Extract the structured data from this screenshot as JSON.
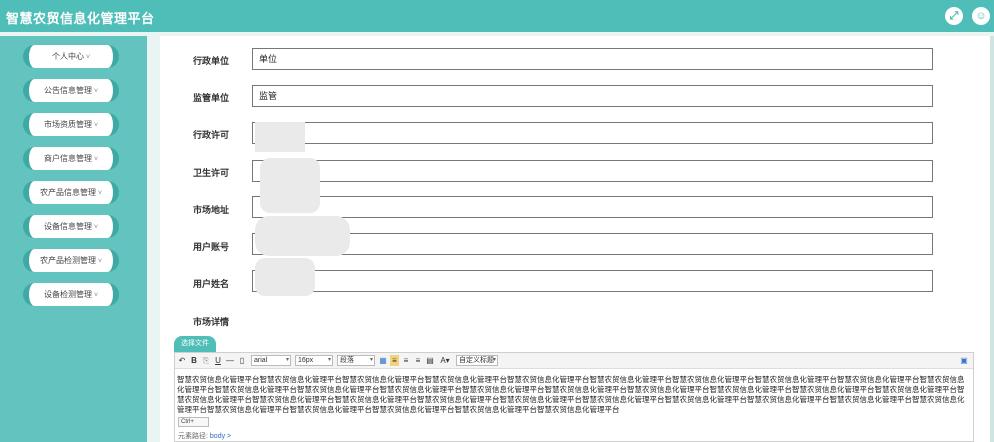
{
  "app": {
    "title": "智慧农贸信息化管理平台"
  },
  "topbar": {
    "fullscreen_icon": "fullscreen-icon",
    "user_icon": "user-icon"
  },
  "sidebar": {
    "items": [
      {
        "label": "个人中心"
      },
      {
        "label": "公告信息管理"
      },
      {
        "label": "市场资质管理"
      },
      {
        "label": "商户信息管理"
      },
      {
        "label": "农产品信息管理"
      },
      {
        "label": "设备信息管理"
      },
      {
        "label": "农产品检测管理"
      },
      {
        "label": "设备检测管理"
      }
    ],
    "caret": "˅"
  },
  "form": {
    "fields": [
      {
        "label": "行政单位",
        "value": "单位"
      },
      {
        "label": "监管单位",
        "value": "监管"
      },
      {
        "label": "行政许可",
        "value": ""
      },
      {
        "label": "卫生许可",
        "value": ""
      },
      {
        "label": "市场地址",
        "value": ""
      },
      {
        "label": "用户账号",
        "value": ""
      },
      {
        "label": "用户姓名",
        "value": ""
      }
    ],
    "detail_label": "市场详情",
    "upload_label": "选择文件"
  },
  "editor": {
    "toolbar": {
      "font_family": "arial",
      "font_size": "16px",
      "paragraph": "段落",
      "custom_title": "自定义标题"
    },
    "content": "智慧农贸信息化管理平台智慧农贸信息化管理平台智慧农贸信息化管理平台智慧农贸信息化管理平台智慧农贸信息化管理平台智慧农贸信息化管理平台智慧农贸信息化管理平台智慧农贸信息化管理平台智慧农贸信息化管理平台智慧农贸信息化管理平台智慧农贸信息化管理平台智慧农贸信息化管理平台智慧农贸信息化管理平台智慧农贸信息化管理平台智慧农贸信息化管理平台智慧农贸信息化管理平台智慧农贸信息化管理平台智慧农贸信息化管理平台智慧农贸信息化管理平台智慧农贸信息化管理平台智慧农贸信息化管理平台智慧农贸信息化管理平台智慧农贸信息化管理平台智慧农贸信息化管理平台智慧农贸信息化管理平台智慧农贸信息化管理平台智慧农贸信息化管理平台智慧农贸信息化管理平台智慧农贸信息化管理平台智慧农贸信息化管理平台智慧农贸信息化管理平台智慧农贸信息化管理平台智慧农贸信息化管理平台智慧农贸信息化管理平台",
    "tag_label": "Ctrl+",
    "status_prefix": "元素路径:",
    "status_path": "body >"
  }
}
